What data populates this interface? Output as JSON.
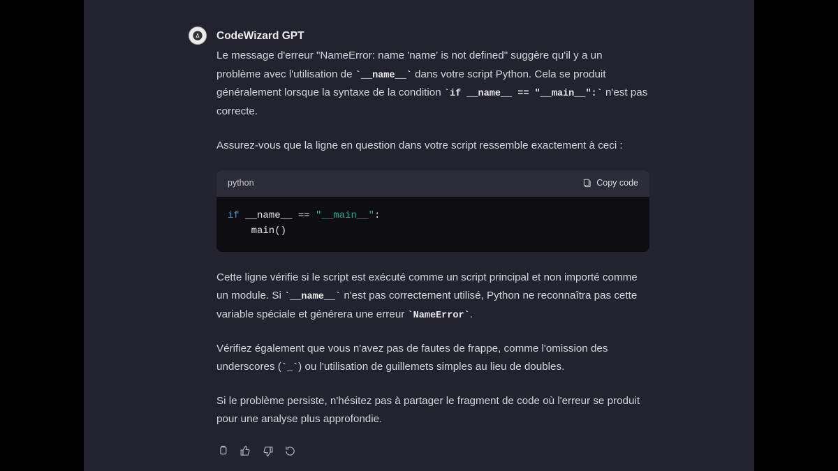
{
  "bot": {
    "name": "CodeWizard GPT"
  },
  "paragraphs": {
    "p1a": "Le message d'erreur \"NameError: name 'name' is not defined\" suggère qu'il y a un problème avec l'utilisation de ",
    "p1_code1": "`__name__`",
    "p1b": " dans votre script Python. Cela se produit généralement lorsque la syntaxe de la condition ",
    "p1_code2": "`if __name__ == \"__main__\":`",
    "p1c": " n'est pas correcte.",
    "p2": "Assurez-vous que la ligne en question dans votre script ressemble exactement à ceci :",
    "p3a": "Cette ligne vérifie si le script est exécuté comme un script principal et non importé comme un module. Si ",
    "p3_code1": "`__name__`",
    "p3b": " n'est pas correctement utilisé, Python ne reconnaîtra pas cette variable spéciale et générera une erreur ",
    "p3_code2": "`NameError`",
    "p3c": ".",
    "p4a": "Vérifiez également que vous n'avez pas de fautes de frappe, comme l'omission des underscores (",
    "p4_code1": "`_`",
    "p4b": ") ou l'utilisation de guillemets simples au lieu de doubles.",
    "p5": "Si le problème persiste, n'hésitez pas à partager le fragment de code où l'erreur se produit pour une analyse plus approfondie."
  },
  "code": {
    "language": "python",
    "copy_label": "Copy code",
    "tokens": {
      "kw_if": "if",
      "name_var": " __name__ == ",
      "str_main": "\"__main__\"",
      "colon": ":",
      "body": "    main()"
    }
  }
}
